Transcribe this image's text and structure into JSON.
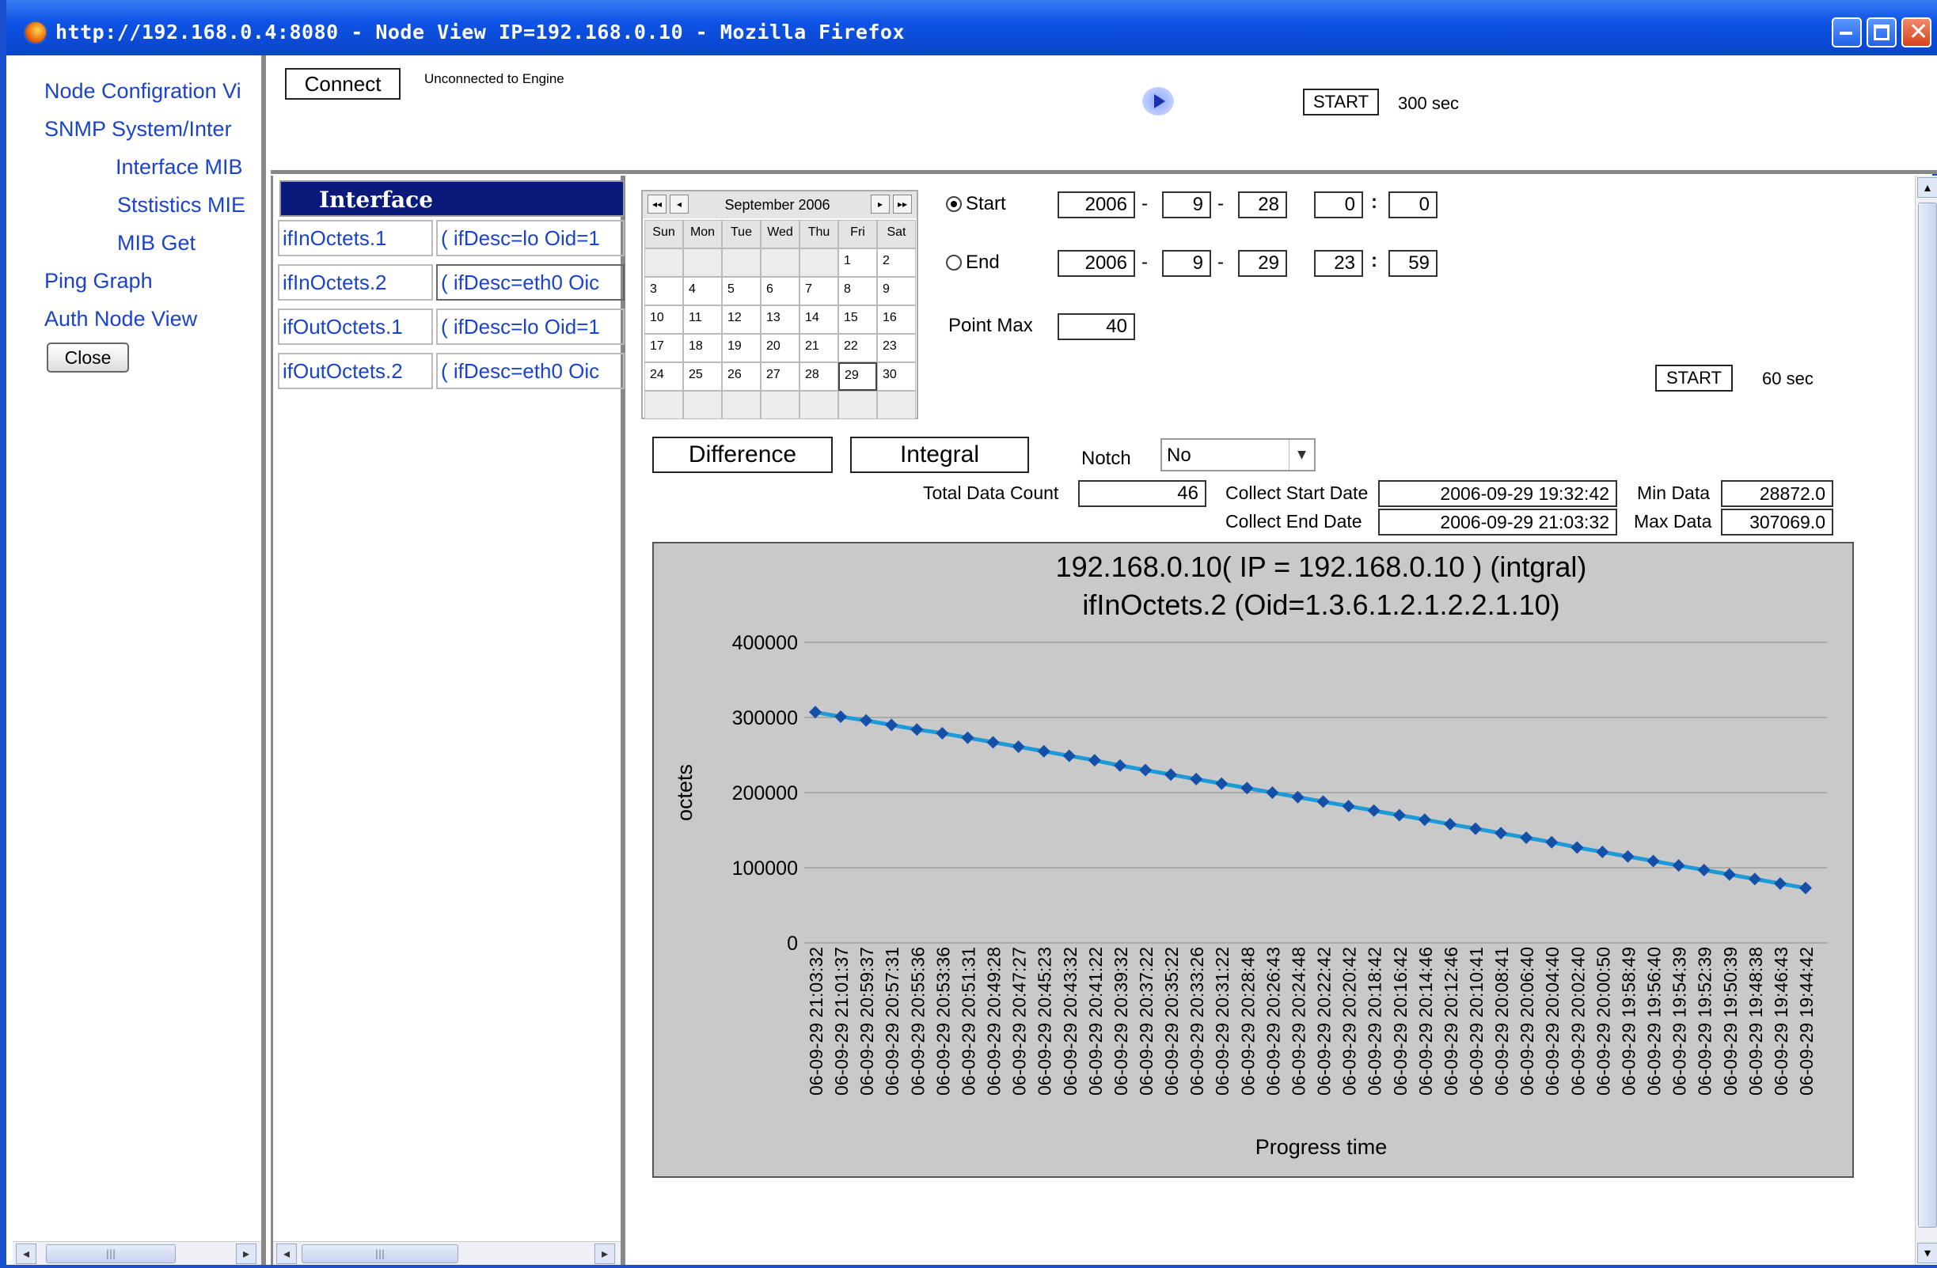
{
  "window": {
    "title": "http://192.168.0.4:8080 - Node View IP=192.168.0.10 - Mozilla Firefox"
  },
  "nav": {
    "items": [
      {
        "label": "Node Configration Vi"
      },
      {
        "label": "SNMP System/Inter"
      },
      {
        "label": "Interface MIB"
      },
      {
        "label": "Ststistics MIE"
      },
      {
        "label": "MIB Get"
      },
      {
        "label": "Ping Graph"
      },
      {
        "label": "Auth Node View"
      }
    ],
    "close_label": "Close"
  },
  "top": {
    "connect_label": "Connect",
    "status": "Unconnected to Engine",
    "start_label": "START",
    "interval": "300  sec"
  },
  "interface": {
    "header": "Interface",
    "rows": [
      {
        "name": "ifInOctets.1",
        "desc": "( ifDesc=lo Oid=1"
      },
      {
        "name": "ifInOctets.2",
        "desc": "( ifDesc=eth0 Oic"
      },
      {
        "name": "ifOutOctets.1",
        "desc": "( ifDesc=lo Oid=1"
      },
      {
        "name": "ifOutOctets.2",
        "desc": "( ifDesc=eth0 Oic"
      }
    ]
  },
  "calendar": {
    "month_label": "September  2006",
    "days_of_week": [
      "Sun",
      "Mon",
      "Tue",
      "Wed",
      "Thu",
      "Fri",
      "Sat"
    ],
    "weeks": [
      [
        "",
        "",
        "",
        "",
        "",
        "1",
        "2"
      ],
      [
        "3",
        "4",
        "5",
        "6",
        "7",
        "8",
        "9"
      ],
      [
        "10",
        "11",
        "12",
        "13",
        "14",
        "15",
        "16"
      ],
      [
        "17",
        "18",
        "19",
        "20",
        "21",
        "22",
        "23"
      ],
      [
        "24",
        "25",
        "26",
        "27",
        "28",
        "29",
        "30"
      ],
      [
        "",
        "",
        "",
        "",
        "",
        "",
        ""
      ]
    ],
    "selected_day": "29",
    "nav_first": "◂◂",
    "nav_prev": "◂",
    "nav_next": "▸",
    "nav_last": "▸▸"
  },
  "range": {
    "start_label": "Start",
    "start": {
      "year": "2006",
      "month": "9",
      "day": "28",
      "hour": "0",
      "minute": "0"
    },
    "end_label": "End",
    "end": {
      "year": "2006",
      "month": "9",
      "day": "29",
      "hour": "23",
      "minute": "59"
    },
    "point_max_label": "Point Max",
    "point_max": "40",
    "start_btn": "START",
    "interval": "60  sec",
    "dash": "-",
    "colon": ":"
  },
  "controls": {
    "difference_label": "Difference",
    "integral_label": "Integral",
    "notch_label": "Notch",
    "notch_value": "No"
  },
  "stats": {
    "total_count_label": "Total Data Count",
    "total_count": "46",
    "collect_start_label": "Collect Start Date",
    "collect_start": "2006-09-29 19:32:42",
    "collect_end_label": "Collect End Date",
    "collect_end": "2006-09-29 21:03:32",
    "min_label": "Min Data",
    "min": "28872.0",
    "max_label": "Max Data",
    "max": "307069.0"
  },
  "chart_data": {
    "type": "line",
    "title": "192.168.0.10( IP = 192.168.0.10 ) (intgral)",
    "subtitle": "ifInOctets.2 (Oid=1.3.6.1.2.1.2.2.1.10)",
    "xlabel": "Progress time",
    "ylabel": "octets",
    "ylim": [
      0,
      400000
    ],
    "yticks": [
      0,
      100000,
      200000,
      300000,
      400000
    ],
    "grid": true,
    "x": [
      "06-09-29 21:03:32",
      "06-09-29 21:01:37",
      "06-09-29 20:59:37",
      "06-09-29 20:57:31",
      "06-09-29 20:55:36",
      "06-09-29 20:53:36",
      "06-09-29 20:51:31",
      "06-09-29 20:49:28",
      "06-09-29 20:47:27",
      "06-09-29 20:45:23",
      "06-09-29 20:43:32",
      "06-09-29 20:41:22",
      "06-09-29 20:39:32",
      "06-09-29 20:37:22",
      "06-09-29 20:35:22",
      "06-09-29 20:33:26",
      "06-09-29 20:31:22",
      "06-09-29 20:28:48",
      "06-09-29 20:26:43",
      "06-09-29 20:24:48",
      "06-09-29 20:22:42",
      "06-09-29 20:20:42",
      "06-09-29 20:18:42",
      "06-09-29 20:16:42",
      "06-09-29 20:14:46",
      "06-09-29 20:12:46",
      "06-09-29 20:10:41",
      "06-09-29 20:08:41",
      "06-09-29 20:06:40",
      "06-09-29 20:04:40",
      "06-09-29 20:02:40",
      "06-09-29 20:00:50",
      "06-09-29 19:58:49",
      "06-09-29 19:56:40",
      "06-09-29 19:54:39",
      "06-09-29 19:52:39",
      "06-09-29 19:50:39",
      "06-09-29 19:48:38",
      "06-09-29 19:46:43",
      "06-09-29 19:44:42"
    ],
    "series": [
      {
        "color": "#1f9ad8",
        "marker_color": "#1550a8",
        "values": [
          307069,
          301000,
          296000,
          290000,
          284000,
          279000,
          273000,
          267000,
          261000,
          255000,
          249000,
          243000,
          236000,
          230000,
          224000,
          218000,
          212000,
          206000,
          200000,
          194000,
          188000,
          182000,
          176000,
          170000,
          164000,
          158000,
          152000,
          146000,
          140000,
          134000,
          127000,
          121000,
          115000,
          109000,
          103000,
          97000,
          91000,
          85000,
          79000,
          73000
        ]
      }
    ]
  },
  "scroll": {
    "left": "◂",
    "right": "▸",
    "thumb": "|||",
    "up": "▴",
    "down": "▾"
  }
}
